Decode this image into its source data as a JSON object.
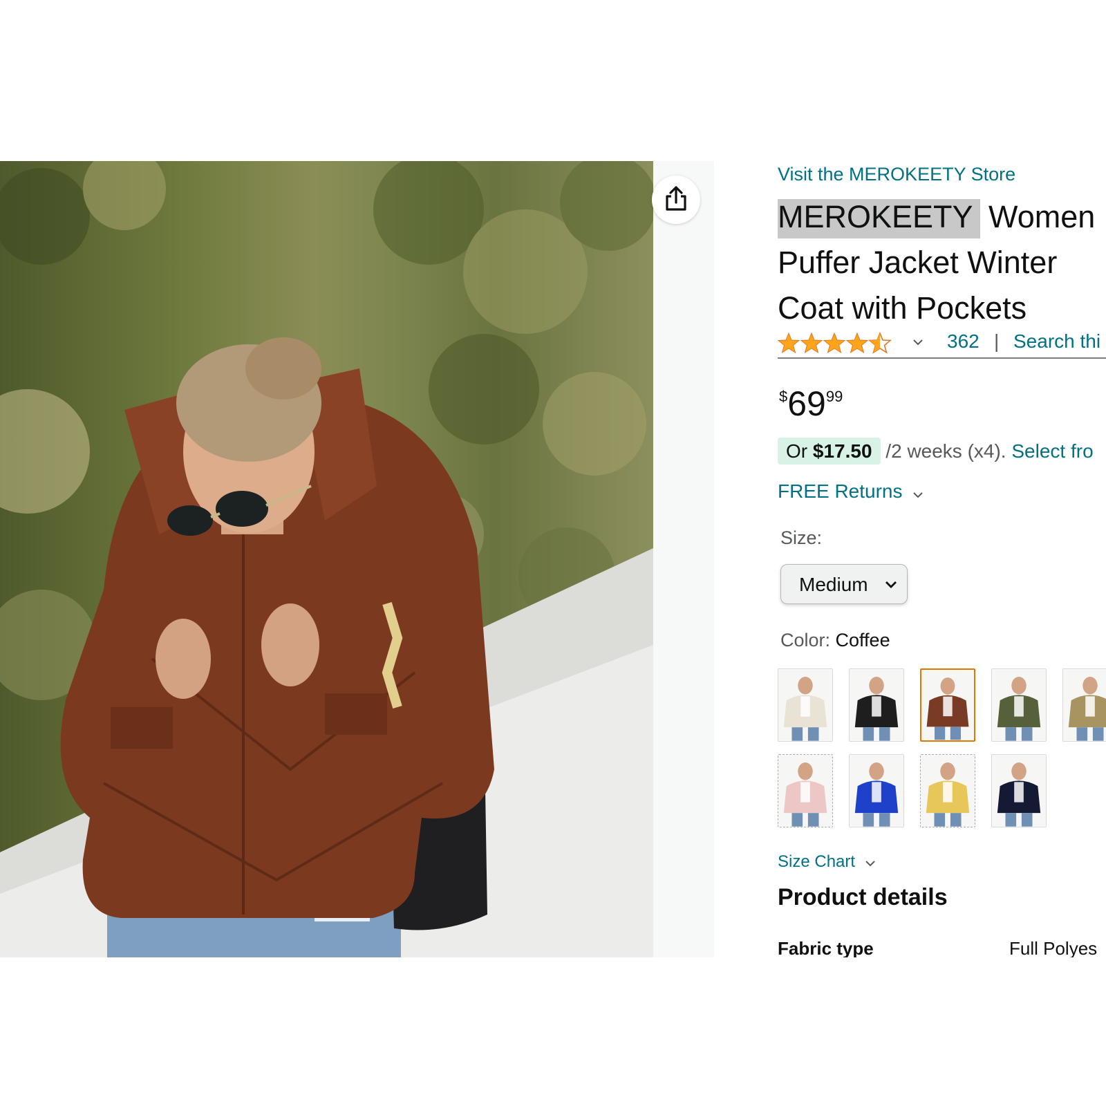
{
  "product": {
    "store_link": "Visit the MEROKEETY Store",
    "title_brand": "MEROKEETY",
    "title_line1_rest": " Women",
    "title_line2": "Puffer Jacket Winter",
    "title_line3": "Coat with Pockets",
    "rating_stars": 4.5,
    "rating_count": "362",
    "rating_separator": "|",
    "search_link": "Search thi",
    "price": {
      "currency": "$",
      "whole": "69",
      "fraction": "99"
    },
    "installment": {
      "prefix": "Or ",
      "amount": "$17.50",
      "schedule": " /2 weeks (x4).",
      "link": " Select fro"
    },
    "returns_link": "FREE Returns",
    "size": {
      "label": "Size:",
      "selected": "Medium"
    },
    "color": {
      "label": "Color: ",
      "selected": "Coffee",
      "swatches": [
        {
          "name": "cream",
          "jacket": "#e9e3d6"
        },
        {
          "name": "black",
          "jacket": "#1e1e1e"
        },
        {
          "name": "coffee",
          "jacket": "#7a3b24"
        },
        {
          "name": "olive",
          "jacket": "#56603a"
        },
        {
          "name": "khaki",
          "jacket": "#a89460"
        },
        {
          "name": "pink",
          "jacket": "#edc6c6"
        },
        {
          "name": "royal-blue",
          "jacket": "#1f40c8"
        },
        {
          "name": "yellow",
          "jacket": "#e7c65a"
        },
        {
          "name": "navy",
          "jacket": "#141a33"
        }
      ]
    },
    "size_chart_link": "Size Chart",
    "details_heading": "Product details",
    "details": [
      {
        "key": "Fabric type",
        "value": "Full Polyes"
      }
    ]
  },
  "colors": {
    "link": "#007185",
    "star": "#ffa41c",
    "selected_swatch_border": "#e77600",
    "installment_pill": "#d9f2e6",
    "brand_highlight": "#c8c8c8"
  },
  "icons": {
    "share": "share-icon",
    "chevron": "chevron-down-icon",
    "star": "star-icon"
  }
}
